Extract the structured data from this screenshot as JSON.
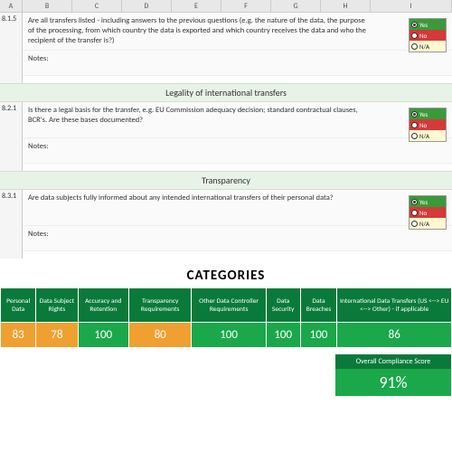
{
  "columns": [
    "A",
    "B",
    "C",
    "D",
    "E",
    "F",
    "G",
    "H",
    "I"
  ],
  "items": [
    {
      "ref": "8.1.5",
      "question": "Are all transfers listed - including answers to the previous questions (e.g. the nature of the data, the purpose of the processing, from which country the data is exported and which country receives the data and who the recipient of the transfer is?)",
      "notes_label": "Notes:",
      "radio": {
        "yes": "Yes",
        "no": "No",
        "na": "N/A",
        "selected": "yes"
      }
    },
    {
      "section": "Legality of international transfers",
      "ref": "8.2.1",
      "question": "Is there a legal basis for the transfer, e.g. EU Commission adequacy decision; standard contractual clauses, BCR's. Are these bases documented?",
      "notes_label": "Notes:",
      "radio": {
        "yes": "Yes",
        "no": "No",
        "na": "N/A",
        "selected": "yes"
      }
    },
    {
      "section": "Transparency",
      "ref": "8.3.1",
      "question": "Are data subjects fully informed about any intended international transfers of their personal data?",
      "notes_label": "Notes:",
      "radio": {
        "yes": "Yes",
        "no": "No",
        "na": "N/A",
        "selected": "yes"
      }
    }
  ],
  "categories_title": "CATEGORIES",
  "categories": {
    "headers": [
      "Personal Data",
      "Data Subject Rights",
      "Accuracy and Retention",
      "Transparency Requirements",
      "Other Data Controller Requirements",
      "Data Security",
      "Data Breaches",
      "International Data Transfers (US <--> EU <--> Other) - if applicable"
    ],
    "scores": [
      {
        "v": "83",
        "c": "amber"
      },
      {
        "v": "78",
        "c": "amber"
      },
      {
        "v": "100",
        "c": "green"
      },
      {
        "v": "80",
        "c": "amber"
      },
      {
        "v": "100",
        "c": "green"
      },
      {
        "v": "100",
        "c": "green"
      },
      {
        "v": "100",
        "c": "green"
      },
      {
        "v": "86",
        "c": "green"
      }
    ]
  },
  "overall": {
    "label": "Overall Compliance Score",
    "value": "91%"
  }
}
